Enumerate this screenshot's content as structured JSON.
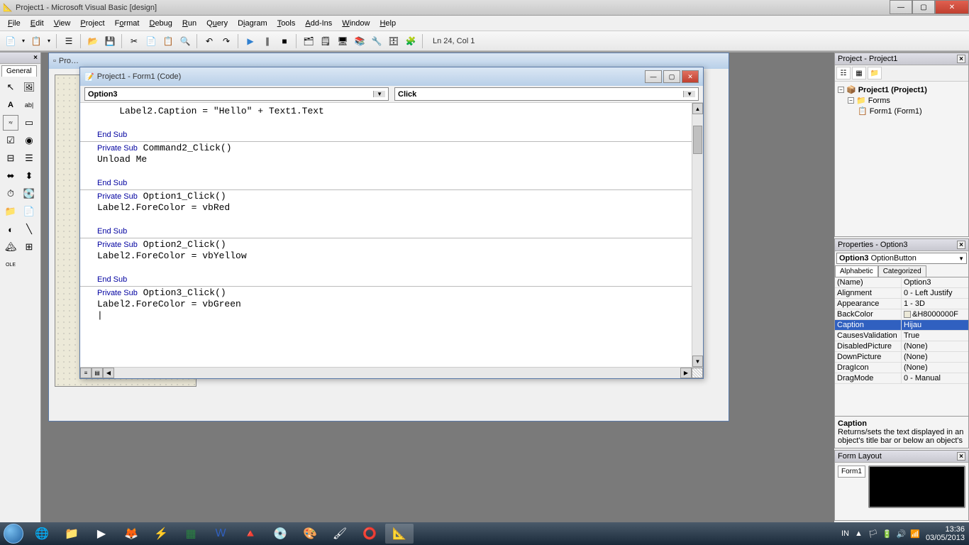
{
  "titlebar": {
    "title": "Project1 - Microsoft Visual Basic [design]"
  },
  "menubar": {
    "items": [
      {
        "label": "File",
        "ul": "F"
      },
      {
        "label": "Edit",
        "ul": "E"
      },
      {
        "label": "View",
        "ul": "V"
      },
      {
        "label": "Project",
        "ul": "P"
      },
      {
        "label": "Format",
        "ul": "o"
      },
      {
        "label": "Debug",
        "ul": "D"
      },
      {
        "label": "Run",
        "ul": "R"
      },
      {
        "label": "Query",
        "ul": "u"
      },
      {
        "label": "Diagram",
        "ul": "i"
      },
      {
        "label": "Tools",
        "ul": "T"
      },
      {
        "label": "Add-Ins",
        "ul": "A"
      },
      {
        "label": "Window",
        "ul": "W"
      },
      {
        "label": "Help",
        "ul": "H"
      }
    ]
  },
  "toolbar_status": "Ln 24, Col 1",
  "toolbox": {
    "title": "",
    "tab": "General"
  },
  "bg_window": {
    "title": "Pro…"
  },
  "codewin": {
    "title": "Project1 - Form1 (Code)",
    "object_dd": "Option3",
    "proc_dd": "Click",
    "code": "    Label2.Caption = \"Hello\" + Text1.Text\n\n<span class=\"kw\">End Sub</span>\n<hr><span class=\"kw\">Private Sub</span> Command2_Click()\nUnload Me\n\n<span class=\"kw\">End Sub</span>\n<hr><span class=\"kw\">Private Sub</span> Option1_Click()\nLabel2.ForeColor = vbRed\n\n<span class=\"kw\">End Sub</span>\n<hr><span class=\"kw\">Private Sub</span> Option2_Click()\nLabel2.ForeColor = vbYellow\n\n<span class=\"kw\">End Sub</span>\n<hr><span class=\"kw\">Private Sub</span> Option3_Click()\nLabel2.ForeColor = vbGreen\n|"
  },
  "project_panel": {
    "title": "Project - Project1",
    "root": "Project1 (Project1)",
    "folder": "Forms",
    "item": "Form1 (Form1)"
  },
  "props_panel": {
    "title": "Properties - Option3",
    "object_name": "Option3",
    "object_type": "OptionButton",
    "tabs": {
      "alphabetic": "Alphabetic",
      "categorized": "Categorized"
    },
    "rows": [
      {
        "name": "(Name)",
        "val": "Option3"
      },
      {
        "name": "Alignment",
        "val": "0 - Left Justify"
      },
      {
        "name": "Appearance",
        "val": "1 - 3D"
      },
      {
        "name": "BackColor",
        "val": "&H8000000F",
        "swatch": true
      },
      {
        "name": "Caption",
        "val": "Hijau",
        "selected": true
      },
      {
        "name": "CausesValidation",
        "val": "True"
      },
      {
        "name": "DisabledPicture",
        "val": "(None)"
      },
      {
        "name": "DownPicture",
        "val": "(None)"
      },
      {
        "name": "DragIcon",
        "val": "(None)"
      },
      {
        "name": "DragMode",
        "val": "0 - Manual"
      }
    ],
    "desc_title": "Caption",
    "desc_text": "Returns/sets the text displayed in an object's title bar or below an object's"
  },
  "formlayout": {
    "title": "Form Layout",
    "form_label": "Form1"
  },
  "systray": {
    "lang": "IN",
    "time": "13:36",
    "date": "03/05/2013"
  }
}
